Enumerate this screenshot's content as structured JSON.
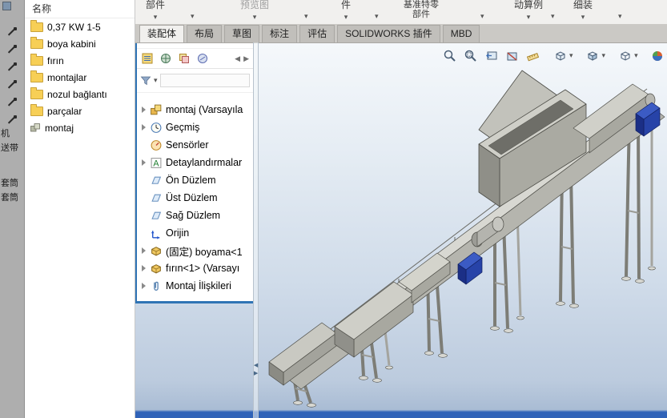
{
  "icons": {
    "caret": "▾",
    "arrow_left": "◀",
    "arrow_right": "▶",
    "annotation_letter": "A"
  },
  "left_strip": {
    "labels": [
      "机",
      "送带",
      "套筒",
      "套筒"
    ]
  },
  "file_panel": {
    "header": "名称",
    "items": [
      "0,37 KW 1-5",
      "boya kabini",
      "fırın",
      "montajlar",
      "nozul bağlantı",
      "parçalar",
      "montaj"
    ]
  },
  "ribbon": {
    "items": [
      {
        "label": "部件"
      },
      {
        "label": "预览图"
      },
      {
        "label": "件"
      },
      {
        "label": "基准特零",
        "label2": "部件"
      },
      {
        "label": "动算例"
      },
      {
        "label": "细装"
      }
    ]
  },
  "tabs": [
    "装配体",
    "布局",
    "草图",
    "标注",
    "评估",
    "SOLIDWORKS 插件",
    "MBD"
  ],
  "feature_tree": {
    "items": [
      {
        "label": "montaj (Varsayıla"
      },
      {
        "label": "Geçmiş"
      },
      {
        "label": "Sensörler"
      },
      {
        "label": "Detaylandırmalar"
      },
      {
        "label": "Ön Düzlem"
      },
      {
        "label": "Üst Düzlem"
      },
      {
        "label": "Sağ Düzlem"
      },
      {
        "label": "Orijin"
      },
      {
        "label": "(固定) boyama<1"
      },
      {
        "label": "fırın<1> (Varsayı"
      },
      {
        "label": "Montaj İlişkileri"
      }
    ]
  },
  "viewport": {
    "hud_icons": [
      "zoom-to-fit",
      "zoom-to-area",
      "section-view",
      "previous-view",
      "measure",
      "scene",
      "view-orientation",
      "display-style",
      "edit-appearance"
    ]
  },
  "colors": {
    "accent_blue": "#2f74b5",
    "motor_blue": "#2b4bb0",
    "taskbar_blue": "#2f62b8",
    "folder_yellow": "#f7cf56"
  }
}
